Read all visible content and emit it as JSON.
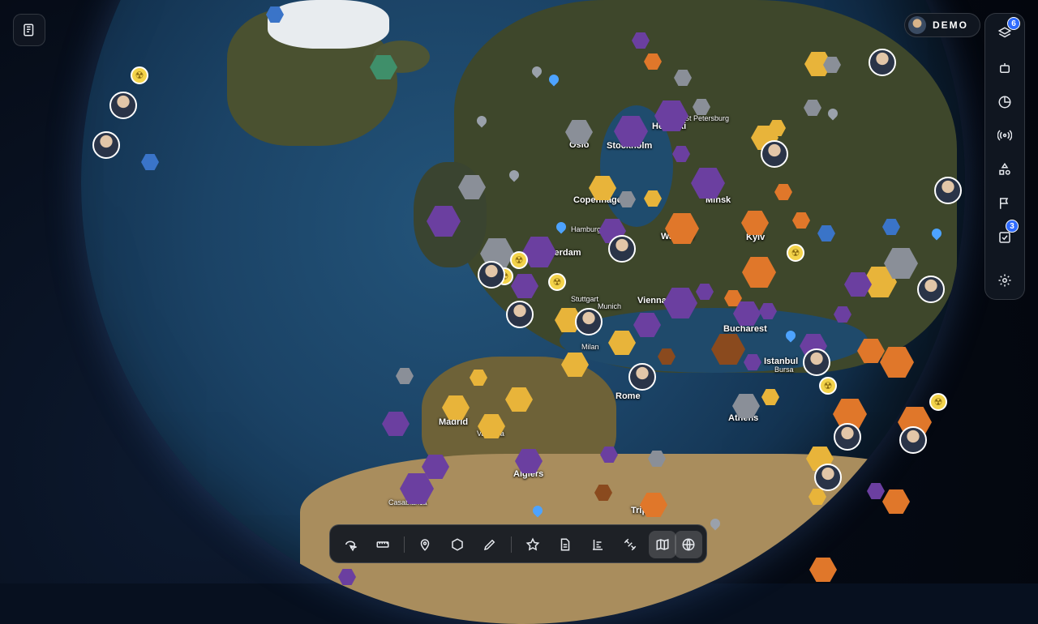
{
  "colors": {
    "accent": "#2f6bff",
    "panel_bg": "#121822",
    "hex_purple": "#6b3fa0",
    "hex_orange": "#e0772a",
    "hex_yellow": "#e8b43a",
    "hex_gray": "#8a8f98",
    "hex_blue": "#3a74c8",
    "hex_brown": "#8a4a1e"
  },
  "account": {
    "label": "DEMO"
  },
  "top_left": {
    "icon": "newspaper-icon"
  },
  "right_rail": {
    "items": [
      {
        "icon": "layers-icon",
        "badge": "6"
      },
      {
        "icon": "robot-icon",
        "badge": ""
      },
      {
        "icon": "pie-chart-icon",
        "badge": ""
      },
      {
        "icon": "broadcast-icon",
        "badge": ""
      },
      {
        "icon": "shapes-icon",
        "badge": ""
      },
      {
        "icon": "flag-icon",
        "badge": ""
      },
      {
        "icon": "checklist-icon",
        "badge": "3"
      },
      {
        "icon": "gear-icon",
        "badge": ""
      }
    ]
  },
  "toolbar": {
    "tools": [
      {
        "icon": "select-lasso-icon",
        "active": false
      },
      {
        "icon": "ruler-icon",
        "active": false
      },
      {
        "icon": "map-pin-icon",
        "active": false
      },
      {
        "icon": "hexagon-icon",
        "active": false
      },
      {
        "icon": "pencil-icon",
        "active": false
      },
      {
        "icon": "star-icon",
        "active": false
      },
      {
        "icon": "document-icon",
        "active": false
      },
      {
        "icon": "bar-chart-icon",
        "active": false
      },
      {
        "icon": "satellite-icon",
        "active": false
      },
      {
        "icon": "map-icon",
        "active": true
      },
      {
        "icon": "globe-icon",
        "active": true
      }
    ]
  },
  "map": {
    "cities": [
      {
        "name": "Oslo"
      },
      {
        "name": "Stockholm"
      },
      {
        "name": "Helsinki"
      },
      {
        "name": "St Petersburg"
      },
      {
        "name": "Copenhagen"
      },
      {
        "name": "Minsk"
      },
      {
        "name": "Hamburg"
      },
      {
        "name": "Warsaw"
      },
      {
        "name": "Kyiv"
      },
      {
        "name": "Amsterdam"
      },
      {
        "name": "Stuttgart"
      },
      {
        "name": "Munich"
      },
      {
        "name": "Vienna"
      },
      {
        "name": "Bucharest"
      },
      {
        "name": "Milan"
      },
      {
        "name": "Istanbul"
      },
      {
        "name": "Bursa"
      },
      {
        "name": "Rome"
      },
      {
        "name": "Athens"
      },
      {
        "name": "Madrid"
      },
      {
        "name": "Valencia"
      },
      {
        "name": "Algiers"
      },
      {
        "name": "Tripoli"
      },
      {
        "name": "Casablanca"
      }
    ]
  }
}
